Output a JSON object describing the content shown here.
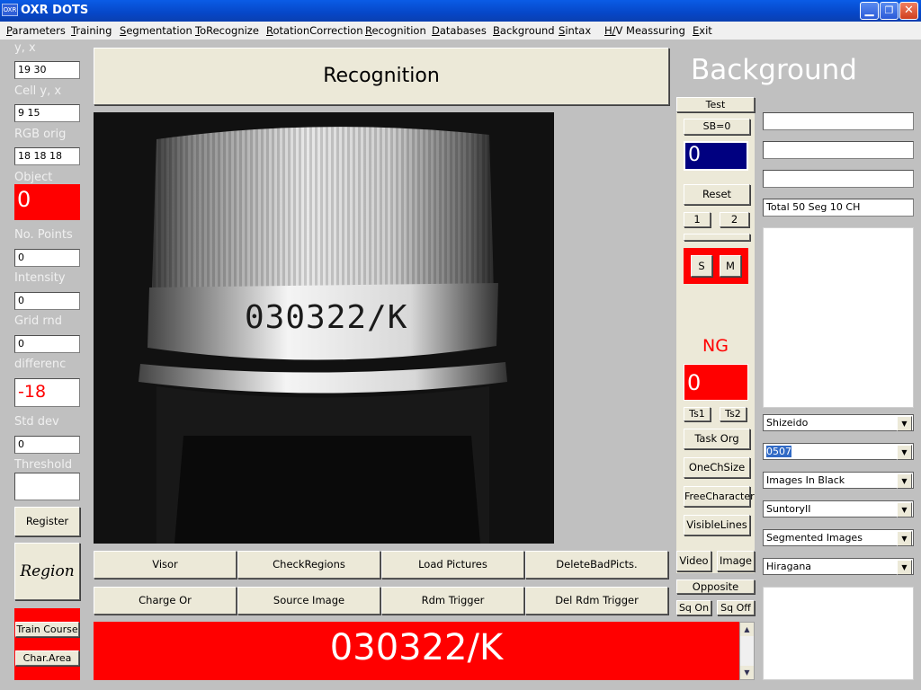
{
  "window": {
    "title": "OXR DOTS",
    "icon_label": "OXR"
  },
  "menu": [
    "Parameters",
    "Training",
    "Segmentation",
    "ToRecognize",
    "RotationCorrection",
    "Recognition",
    "Databases",
    "Background",
    "Sintax",
    "H/V Meassuring",
    "Exit"
  ],
  "left": {
    "yx_label": "y, x",
    "yx_value": "19 30",
    "cell_label": "Cell y, x",
    "cell_value": "9 15",
    "rgb_label": "RGB orig",
    "rgb_value": "18 18 18",
    "object_label": "Object",
    "object_value": "0",
    "points_label": "No. Points",
    "points_value": "0",
    "intensity_label": "Intensity",
    "intensity_value": "0",
    "grid_label": "Grid rnd",
    "grid_value": "0",
    "diff_label": "differenc",
    "diff_value": "-18",
    "std_label": "Std dev",
    "std_value": "0",
    "threshold_label": "Threshold",
    "threshold_value": "",
    "register": "Register",
    "region_logo": "Region",
    "train_course": "Train Course",
    "char_area": "Char.Area"
  },
  "main": {
    "title": "Recognition",
    "image_text": "030322/K",
    "buttons_row1": [
      "Visor",
      "CheckRegions",
      "Load Pictures",
      "DeleteBadPicts."
    ],
    "buttons_row2": [
      "Charge Or",
      "Source Image",
      "Rdm Trigger",
      "Del Rdm Trigger"
    ],
    "result_text": "030322/K"
  },
  "middle": {
    "test": "Test",
    "sb": "SB=0",
    "blue_value": "0",
    "reset": "Reset",
    "b1": "1",
    "b2": "2",
    "s": "S",
    "m": "M",
    "ng_label": "NG",
    "ng_value": "0",
    "ts1": "Ts1",
    "ts2": "Ts2",
    "task_org": "Task Org",
    "one_ch": "OneChSize",
    "free_char": "FreeCharacter",
    "visible_lines": "VisibleLines",
    "video": "Video",
    "image": "Image",
    "opposite": "Opposite",
    "sq_on": "Sq On",
    "sq_off": "Sq Off"
  },
  "right": {
    "title": "Background",
    "field1": "",
    "field2": "",
    "field3": "",
    "total": "Total 50  Seg 10  CH",
    "combos": [
      "Shizeido",
      "0507",
      "Images In Black",
      "SuntoryII",
      "Segmented Images",
      "Hiragana"
    ]
  },
  "colors": {
    "red": "#ff0000",
    "navy": "#000080",
    "panel": "#c0c0c0",
    "button": "#ece9d8"
  }
}
